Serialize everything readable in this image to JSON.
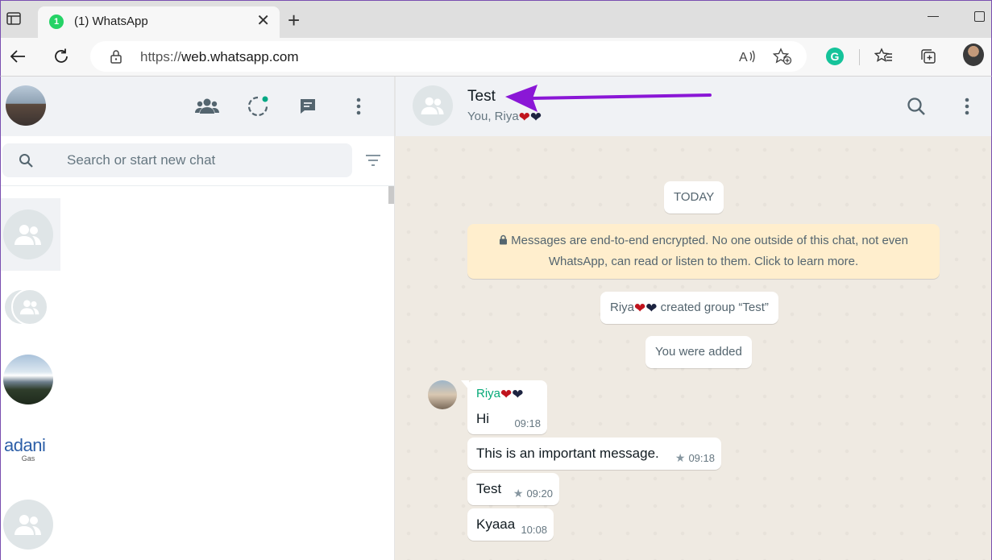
{
  "browser": {
    "tab_title": "(1) WhatsApp",
    "tab_badge": "1",
    "url_prefix": "https://",
    "url_domain": "web.whatsapp.com",
    "grammarly_letter": "G"
  },
  "sidebar": {
    "search_placeholder": "Search or start new chat",
    "chats": [
      {
        "avatar": "group-icon"
      },
      {
        "avatar": "group-icon"
      },
      {
        "avatar": "mountain-photo"
      },
      {
        "avatar": "adani-logo",
        "logo_text": "adani",
        "logo_sub": "Gas"
      },
      {
        "avatar": "group-icon"
      }
    ]
  },
  "chat": {
    "name": "Test",
    "members_prefix": "You, Riya",
    "date_divider": "TODAY",
    "encryption_line1": "Messages are end-to-end encrypted. No one outside of this chat, not even",
    "encryption_line2": "WhatsApp, can read or listen to them. Click to learn more.",
    "system_created_prefix": "Riya",
    "system_created_suffix": " created group “Test”",
    "system_added": "You were added",
    "sender_name": "Riya",
    "messages": [
      {
        "text": "Hi",
        "time": "09:18",
        "starred": false
      },
      {
        "text": "This is an important message.",
        "time": "09:18",
        "starred": true
      },
      {
        "text": "Test",
        "time": "09:20",
        "starred": true
      },
      {
        "text": "Kyaaa",
        "time": "10:08",
        "starred": false
      }
    ]
  },
  "colors": {
    "accent_green": "#25d366",
    "sender_green": "#06a977",
    "annotation_arrow": "#8a17d6"
  }
}
